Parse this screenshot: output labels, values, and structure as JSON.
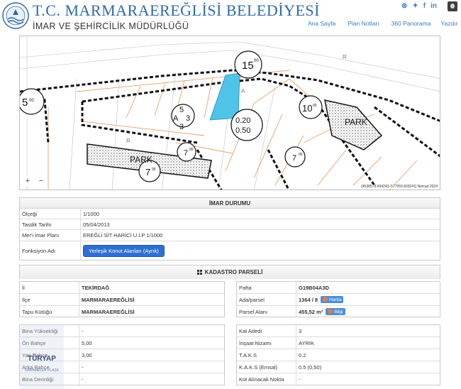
{
  "header": {
    "title": "T.C. MARMARAEREĞLİSİ BELEDİYESİ",
    "subtitle": "İMAR VE ŞEHİRCİLİK MÜDÜRLÜĞÜ",
    "nav": [
      "Ana Sayfa",
      "Plan Notları",
      "360 Panorama",
      "Yazdır"
    ],
    "social": [
      "skype-icon",
      "twitter-icon",
      "facebook-icon",
      "linkedin-icon"
    ]
  },
  "map": {
    "zoom_in": "+",
    "zoom_out": "−",
    "attribution": "[4538578.694243–577059,403241] Netcad 2024",
    "labels": {
      "height_top": "15",
      "height_top_sup": "00",
      "height_right": "10",
      "height_right_sup": "00",
      "height_mid": "7",
      "height_mid_sup": "00",
      "height_low": "7",
      "height_low_sup": "00",
      "height_left": "5",
      "height_left_sup": "00",
      "a3_top": "5",
      "a3_mid": "A",
      "a3_right": "3",
      "a3_bottom": "3",
      "taks": "0.20",
      "kaks": "0.50",
      "park_left": "PARK",
      "park_right": "PARK",
      "road_letter_r": "R",
      "road_letter_a": "A",
      "road_letter_r2": "R"
    }
  },
  "plan_table": {
    "header": "İMAR DURUMU",
    "rows": [
      {
        "key": "Ölçeği",
        "value": "1/1000"
      },
      {
        "key": "Tasdik Tarihi",
        "value": "05/04/2013"
      },
      {
        "key": "Mer'i İmar Planı",
        "value": "EREĞLİ SİT HARİCİ U.İ.P 1/1000"
      },
      {
        "key": "Fonksiyon Adı",
        "value": "Yerleşik Konut Alanları (Ayrık)"
      }
    ]
  },
  "kadastro": {
    "header": "KADASTRO PARSELİ",
    "left": [
      {
        "key": "İl",
        "value": "TEKİRDAĞ"
      },
      {
        "key": "İlçe",
        "value": "MARMARAEREĞLİSİ"
      },
      {
        "key": "Tapu Kütüğü",
        "value": "MARMARAEREĞLİSİ"
      }
    ],
    "right": [
      {
        "key": "Pafta",
        "value": "G19B04A3D"
      },
      {
        "key": "Ada/parsel",
        "value": "1364 / 8",
        "badge": "Harita"
      },
      {
        "key": "Parsel Alanı",
        "value": "455,52 m²",
        "badge": "Bilgi"
      }
    ]
  },
  "yapilasma": {
    "left": [
      {
        "key": "Bina Yüksekliği",
        "value": "-"
      },
      {
        "key": "Ön Bahçe",
        "value": "5,00"
      },
      {
        "key": "Yan Bahçe",
        "value": "3,00"
      },
      {
        "key": "Arka Bahçe",
        "value": "-"
      },
      {
        "key": "Bina Derinliği",
        "value": "-"
      }
    ],
    "right": [
      {
        "key": "Kat Adedi",
        "value": "3"
      },
      {
        "key": "İnşaat Nizamı",
        "value": "AYRIK"
      },
      {
        "key": "T.A.K.S",
        "value": "0.2"
      },
      {
        "key": "K.A.K.S (Emsal)",
        "value": "0.5 (0,50)"
      },
      {
        "key": "Kot Alınacak Nokta",
        "value": "-"
      }
    ]
  },
  "watermark": {
    "brand": "TÜRYAP",
    "sub": "KARAMELEK PLAZA"
  },
  "colors": {
    "title_blue": "#2f6aa8",
    "parcel_highlight": "#4fc3e8",
    "button_blue": "#2e6fd1",
    "plan_line_orange": "#e8a06a"
  }
}
